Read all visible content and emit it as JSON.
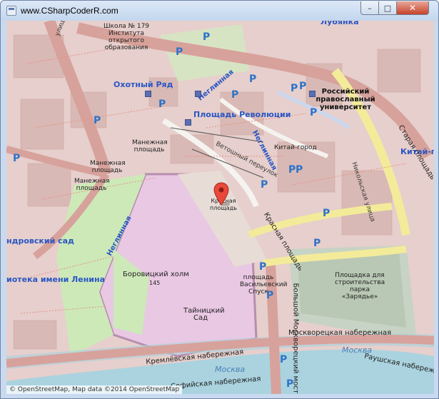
{
  "window": {
    "title": "www.CSharpCoderR.com",
    "minimize_glyph": "–",
    "maximize_glyph": "□",
    "close_glyph": "✕"
  },
  "map": {
    "marker_icon": "map-pin-icon",
    "attribution": "© OpenStreetMap, Map data ©2014 OpenStreetMap",
    "labels": {
      "school": "Школа № 179 Института открытого образования",
      "okhotny_ryad": "Охотный Ряд",
      "ploshchad_revolyutsii": "Площадь Революции",
      "university": "Российский православный университет",
      "lubyanka": "Лубянка",
      "kitay_gorod_station": "Китай-гор",
      "kitay_gorod": "Китай-город",
      "manezhnaya_1": "Манежная площадь",
      "manezhnaya_2": "Манежная площадь",
      "manezhnaya_3": "Манежная площадь",
      "vetoshny": "Ветошный переулок",
      "neglinnaya_1": "Неглинная",
      "neglinnaya_2": "Неглинная",
      "neglinnaya_3": "Неглинная",
      "nikolskaya": "Никольская улица",
      "staraya": "Старая площадь",
      "krasnaya_marker": "Красная площадь",
      "krasnaya_street": "Красная площадь",
      "vasilievsky": "площадь Васильевский Спуск",
      "zaryadye": "Площадка для строительства парка «Зарядье»",
      "borovitsky": "Боровицкий холм",
      "borovitsky_height": "145",
      "taynitsky": "Тайницкий Сад",
      "lenin_library": "иотека имени Ленина",
      "aleksandrovsky": "ндровский сад",
      "ulitsa": "улица",
      "moskvoretskaya": "Москворецкая набережная",
      "kremlevskaya": "Кремлёвская набережная",
      "sofiyskaya": "Софийская набережная",
      "raushskaya": "Раушская набережная",
      "bolshoy_moskvoretsky": "Большой Москворецкий мост",
      "moskva_river": "Москва",
      "moskva_river_2": "Москва"
    },
    "parking_letter": "P",
    "colors": {
      "road_major": "#d9a29a",
      "road_ring": "#c99089",
      "road_yellow": "#f5eea0",
      "block": "#e2c8c5",
      "park": "#cde9b8",
      "kremlin": "#e9c8e3",
      "river": "#aad3df",
      "water_label": "#4c7fb6",
      "parking": "#2d73c8"
    }
  }
}
